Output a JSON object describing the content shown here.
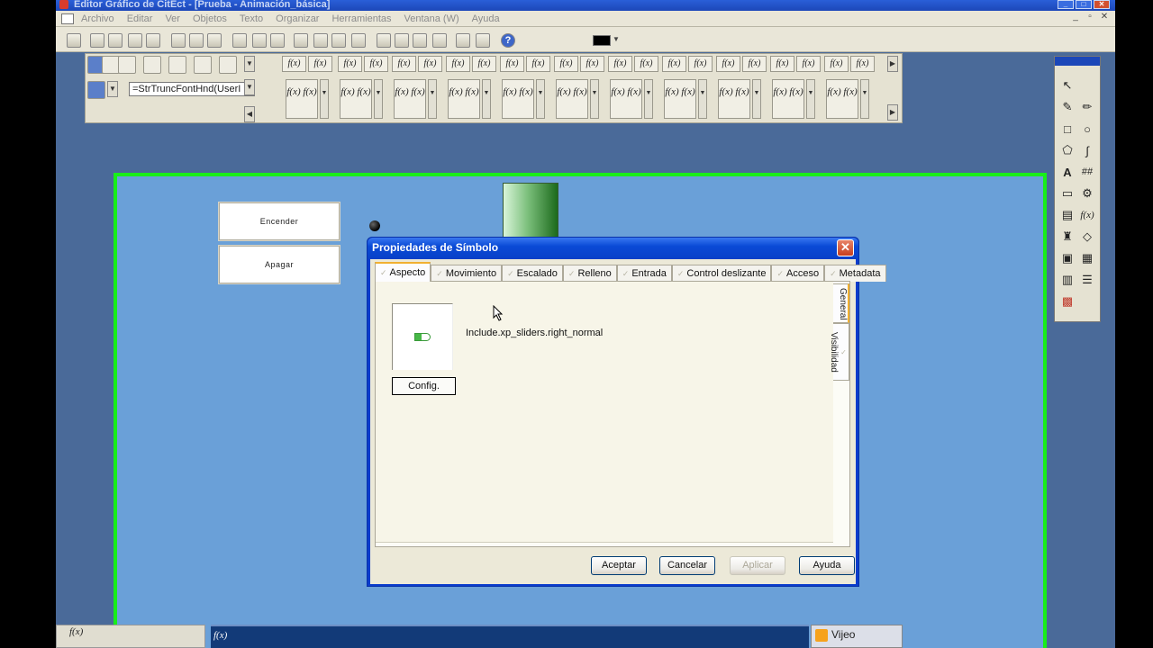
{
  "window": {
    "title": "Editor Gráfico de CitEct - [Prueba - Animación_básica]",
    "buttons": {
      "minimize": "_",
      "maximize": "□",
      "close": "✕"
    }
  },
  "menubar": {
    "items": [
      "Archivo",
      "Editar",
      "Ver",
      "Objetos",
      "Texto",
      "Organizar",
      "Herramientas",
      "Ventana (W)",
      "Ayuda"
    ]
  },
  "toolbar": {
    "help_label": "?",
    "expression_field": "=StrTruncFontHnd(UserI",
    "fx_label": "f(x)",
    "fx_stack": "f(x) f(x)"
  },
  "canvas": {
    "buttons": {
      "on_label": "Encender",
      "off_label": "Apagar"
    }
  },
  "bottom": {
    "fx_left": "f(x)",
    "fx_mid": "f(x)",
    "brand": "Vijeo"
  },
  "dialog": {
    "title": "Propiedades de Símbolo",
    "close_label": "✕",
    "tabs": [
      "Aspecto",
      "Movimiento",
      "Escalado",
      "Relleno",
      "Entrada",
      "Control deslizante",
      "Acceso",
      "Metadata"
    ],
    "active_tab": "Aspecto",
    "vertical_tabs": [
      "General",
      "Visibilidad"
    ],
    "symbol_name": "Include.xp_sliders.right_normal",
    "config_label": "Config.",
    "buttons": {
      "accept": "Aceptar",
      "cancel": "Cancelar",
      "apply": "Aplicar",
      "help": "Ayuda"
    }
  },
  "colors": {
    "canvas_bg": "#6aa0d8",
    "canvas_border": "#19ee19",
    "app_bg": "#4a6a99",
    "dialog_frame": "#0a3ccc",
    "tab_highlight": "#f1b031"
  }
}
